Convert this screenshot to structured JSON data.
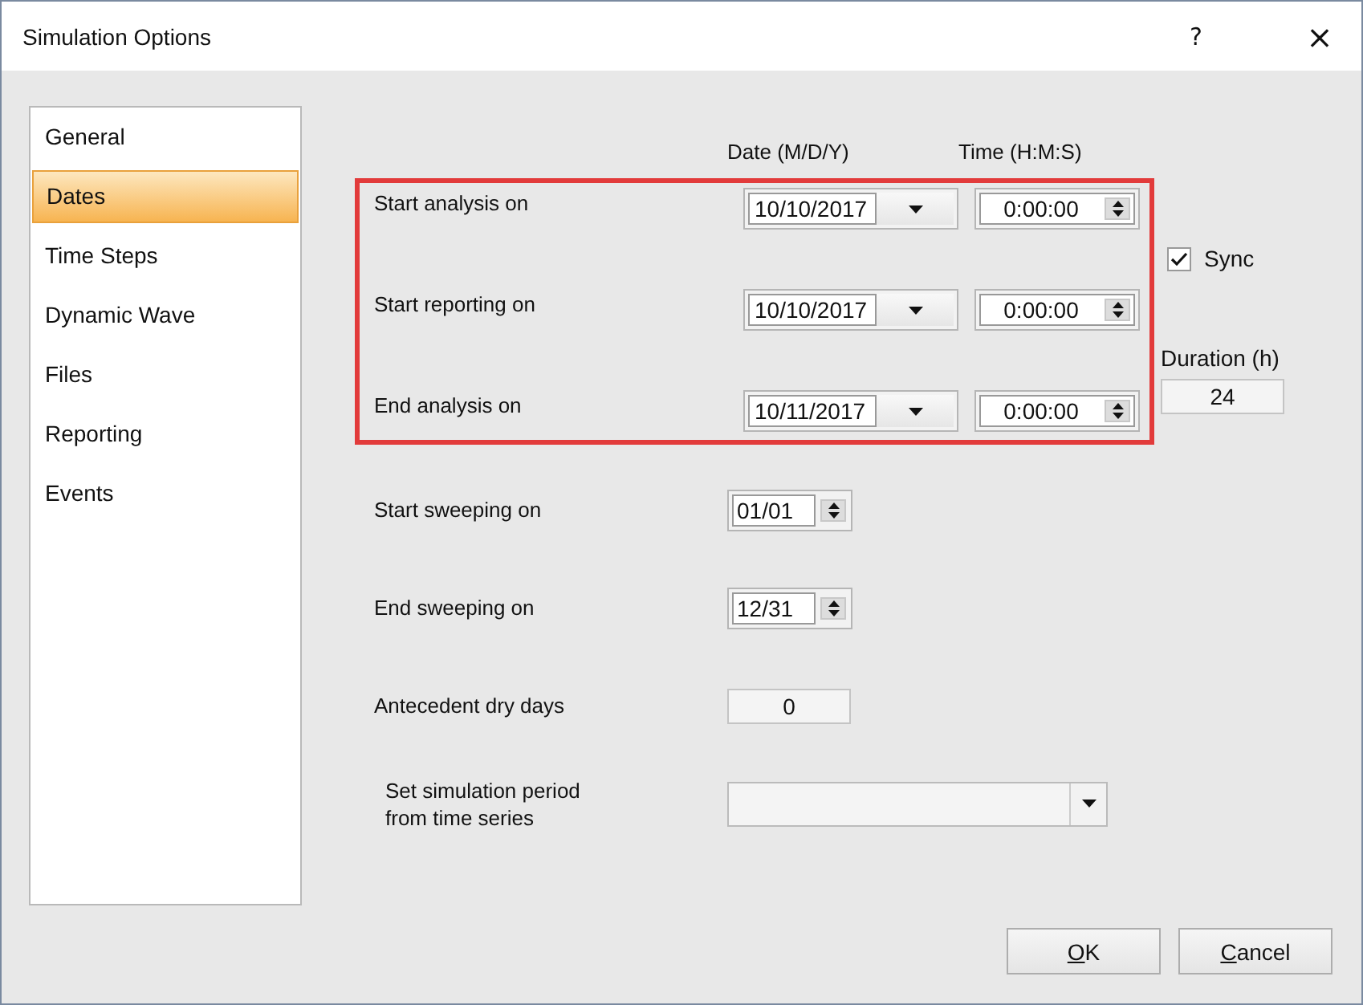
{
  "window": {
    "title": "Simulation Options",
    "help_button": "?",
    "close_button": "×"
  },
  "sidebar": {
    "items": [
      {
        "label": "General",
        "selected": false
      },
      {
        "label": "Dates",
        "selected": true
      },
      {
        "label": "Time Steps",
        "selected": false
      },
      {
        "label": "Dynamic Wave",
        "selected": false
      },
      {
        "label": "Files",
        "selected": false
      },
      {
        "label": "Reporting",
        "selected": false
      },
      {
        "label": "Events",
        "selected": false
      }
    ]
  },
  "columns": {
    "date": "Date (M/D/Y)",
    "time": "Time (H:M:S)"
  },
  "period": {
    "highlighted": true,
    "rows": [
      {
        "label": "Start analysis on",
        "date": "10/10/2017",
        "time": "0:00:00"
      },
      {
        "label": "Start reporting on",
        "date": "10/10/2017",
        "time": "0:00:00"
      },
      {
        "label": "End analysis on",
        "date": "10/11/2017",
        "time": "0:00:00"
      }
    ]
  },
  "sync": {
    "label": "Sync",
    "checked": true
  },
  "duration": {
    "label": "Duration (h)",
    "value": "24"
  },
  "other_rows": [
    {
      "kind": "spin",
      "label": "Start sweeping on",
      "value": "01/01"
    },
    {
      "kind": "spin",
      "label": "End sweeping on",
      "value": "12/31"
    },
    {
      "kind": "text",
      "label": "Antecedent dry days",
      "value": "0"
    },
    {
      "kind": "combo",
      "label": "Set simulation period\nfrom time series"
    }
  ],
  "buttons": [
    {
      "label": "OK",
      "mnemonic_underlined": true
    },
    {
      "label": "Cancel",
      "mnemonic_underlined": true
    }
  ]
}
